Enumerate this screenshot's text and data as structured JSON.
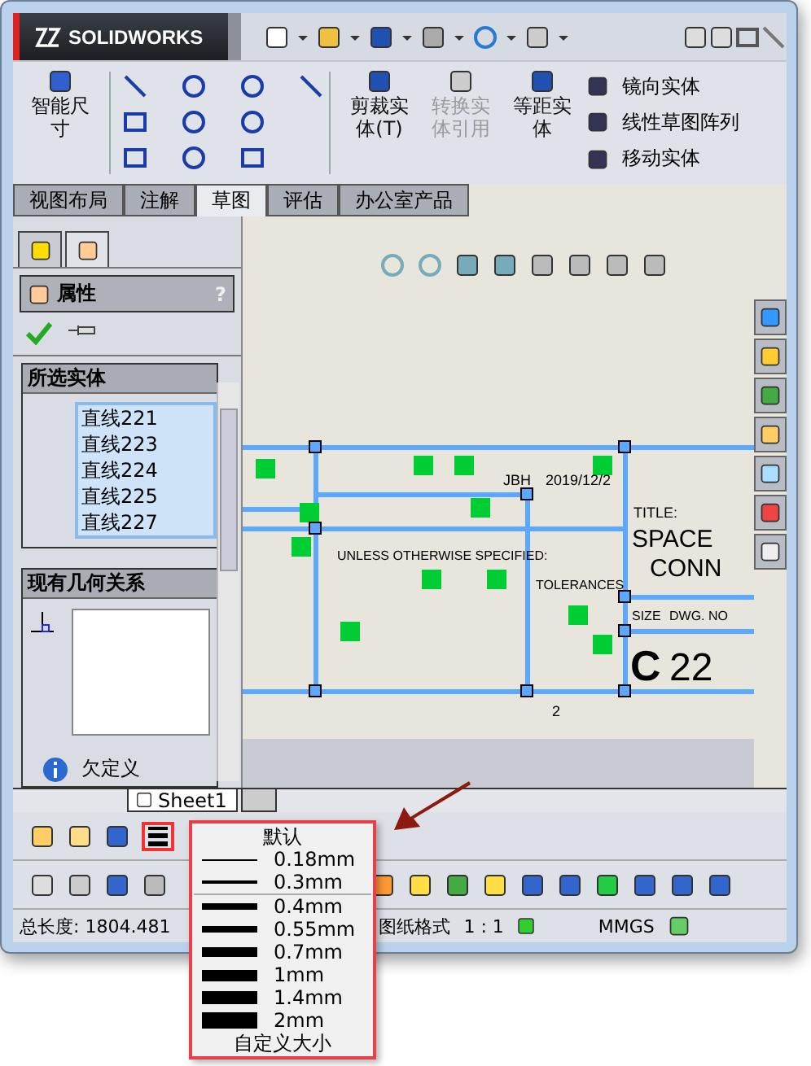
{
  "app": {
    "logo": "SOLIDWORKS"
  },
  "ribbon": {
    "smart_dimension": "智能尺寸",
    "commands": [
      {
        "label": "剪裁实体(T)",
        "disabled": false
      },
      {
        "label": "转换实体引用",
        "disabled": true
      },
      {
        "label": "等距实体",
        "disabled": false
      }
    ],
    "list": [
      "镜向实体",
      "线性草图阵列",
      "移动实体"
    ]
  },
  "tabs": [
    {
      "label": "视图布局",
      "selected": false
    },
    {
      "label": "注解",
      "selected": false
    },
    {
      "label": "草图",
      "selected": true
    },
    {
      "label": "评估",
      "selected": false
    },
    {
      "label": "办公室产品",
      "selected": false
    }
  ],
  "panel": {
    "title": "属性",
    "help": "?",
    "selected_section": {
      "title": "所选实体",
      "items": [
        "直线221",
        "直线223",
        "直线224",
        "直线225",
        "直线227"
      ]
    },
    "relations_section": {
      "title": "现有几何关系"
    },
    "status": "欠定义"
  },
  "drawing": {
    "labels": [
      "JBH",
      "2019/12/2",
      "TITLE:",
      "SPACE",
      "CONN",
      "UNLESS OTHERWISE SPECIFIED:",
      "TOLERANCES",
      "SIZE",
      "DWG. NO",
      "C",
      "22",
      "2"
    ]
  },
  "sheet_tabs": [
    {
      "label": "Sheet1",
      "selected": true
    }
  ],
  "status_bar": {
    "length": "总长度: 1804.481",
    "mode": "图纸格式",
    "scale": "1 : 1",
    "units": "MMGS"
  },
  "line_menu": {
    "header": "默认",
    "groups": [
      [
        "0.18mm",
        "0.3mm"
      ],
      [
        "0.4mm",
        "0.55mm",
        "0.7mm",
        "1mm",
        "1.4mm",
        "2mm"
      ]
    ],
    "footer": "自定义大小"
  }
}
